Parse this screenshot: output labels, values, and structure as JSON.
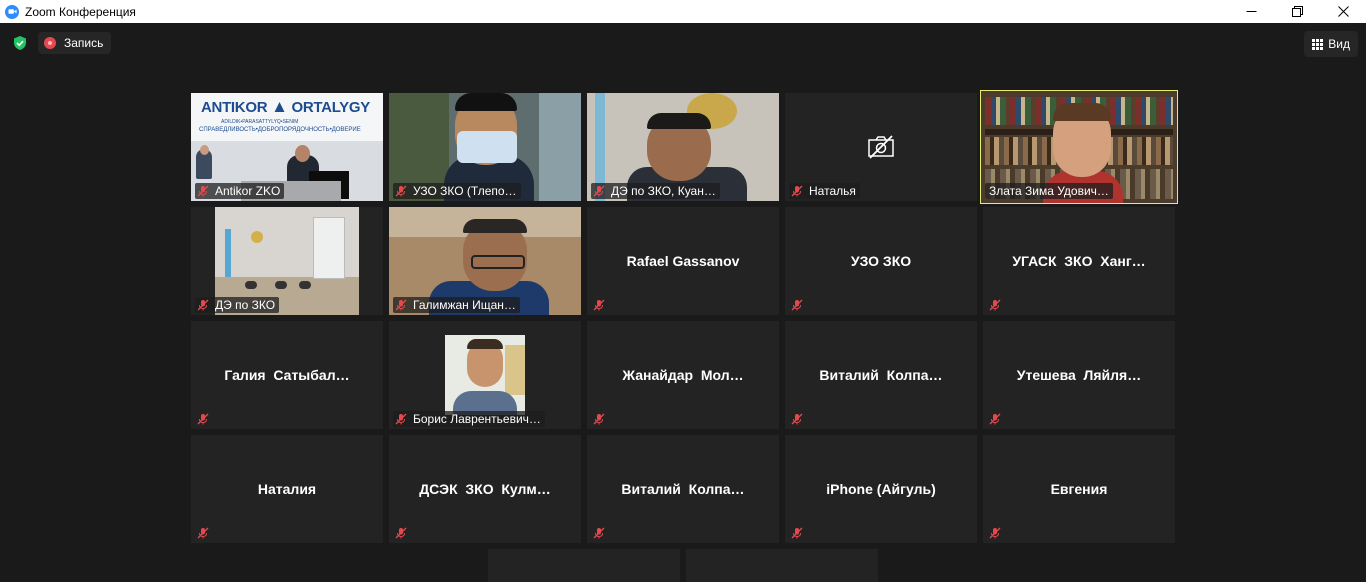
{
  "window": {
    "title": "Zoom Конференция"
  },
  "toolbar": {
    "record_label": "Запись",
    "view_label": "Вид"
  },
  "banner": {
    "brand_left": "ANTIKOR",
    "brand_right": "ORTALYGY",
    "motto_kz": "ADILDIK•PARASATTYLYQ•SENIM",
    "motto_ru": "СПРАВЕДЛИВОСТЬ•ДОБРОПОРЯДОЧНОСТЬ•ДОВЕРИЕ"
  },
  "participants": [
    {
      "name": "Antikor ZKO",
      "video": true
    },
    {
      "name": "УЗО ЗКО (Тлепо…",
      "video": true
    },
    {
      "name": "ДЭ по ЗКО, Куан…",
      "video": true
    },
    {
      "name": "Наталья",
      "video": false,
      "camera_off": true
    },
    {
      "name": "Злата Зима Удович…",
      "video": true,
      "active_speaker": true
    },
    {
      "name": "ДЭ по ЗКО",
      "video": true
    },
    {
      "name": "Галимжан Ищан…",
      "video": true
    },
    {
      "name": "Rafael Gassanov",
      "video": false
    },
    {
      "name": "УЗО ЗКО",
      "video": false
    },
    {
      "name": "УГАСК  ЗКО  Ханг…",
      "video": false
    },
    {
      "name": "Галия  Сатыбал…",
      "video": false
    },
    {
      "name": "Борис Лаврентьевич…",
      "video": true
    },
    {
      "name": "Жанайдар  Мол…",
      "video": false
    },
    {
      "name": "Виталий  Колпа…",
      "video": false
    },
    {
      "name": "Утешева  Ляйля…",
      "video": false
    },
    {
      "name": "Наталия",
      "video": false
    },
    {
      "name": "ДСЭК  ЗКО  Кулм…",
      "video": false
    },
    {
      "name": "Виталий  Колпа…",
      "video": false
    },
    {
      "name": "iPhone (Айгуль)",
      "video": false
    },
    {
      "name": "Евгения",
      "video": false
    }
  ],
  "colors": {
    "active_border": "#e4ec6a",
    "muted_mic": "#e5484d",
    "tile_bg": "#232323"
  }
}
